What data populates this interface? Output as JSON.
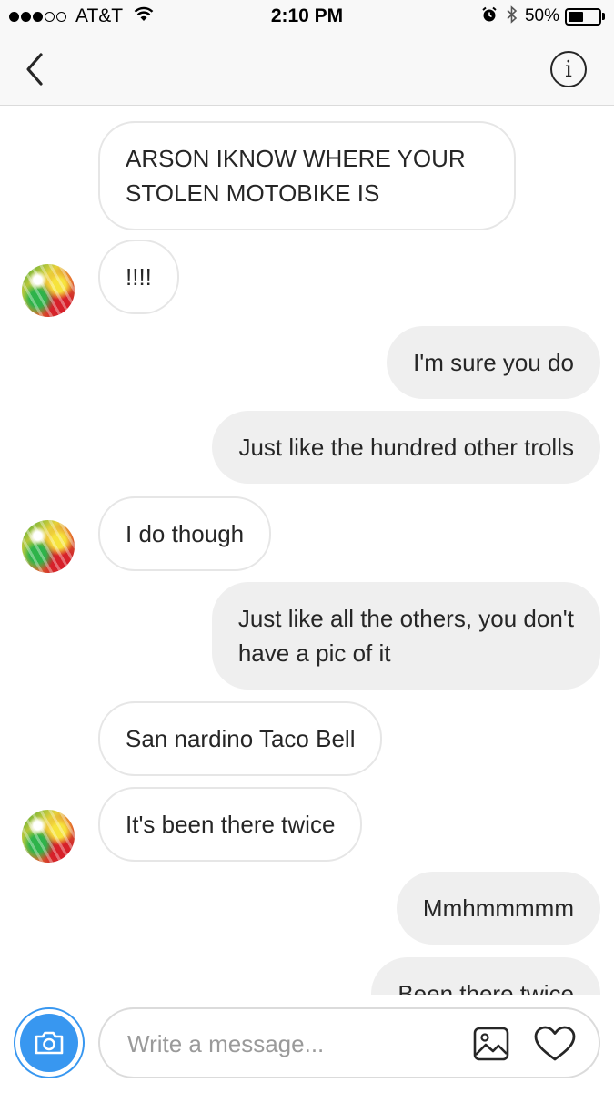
{
  "status_bar": {
    "carrier": "AT&T",
    "time": "2:10 PM",
    "battery_percent": "50%",
    "battery_level": 0.5,
    "signal_bars_filled": 3,
    "signal_bars_total": 5
  },
  "nav": {
    "back_icon": "chevron-left-icon",
    "info_icon": "info-icon",
    "info_glyph": "i"
  },
  "messages": [
    {
      "direction": "incoming",
      "text_lines": [
        "ARSON IKNOW WHERE YOUR",
        "STOLEN MOTOBIKE IS"
      ]
    },
    {
      "direction": "incoming",
      "text": "!!!!",
      "avatar": true
    },
    {
      "direction": "outgoing",
      "text": "I'm sure you do"
    },
    {
      "direction": "outgoing",
      "text": "Just like the hundred other trolls"
    },
    {
      "direction": "incoming",
      "text": "I do though",
      "avatar": true
    },
    {
      "direction": "outgoing",
      "text_lines": [
        "Just like all the others, you don't",
        "have a pic of it"
      ]
    },
    {
      "direction": "incoming",
      "text": "San nardino Taco Bell"
    },
    {
      "direction": "incoming",
      "text": "It's been there twice",
      "avatar": true
    },
    {
      "direction": "outgoing",
      "text": "Mmhmmmmm"
    },
    {
      "direction": "outgoing",
      "text": "Been there twice",
      "partially_visible": true
    }
  ],
  "composer": {
    "placeholder": "Write a message...",
    "camera_icon": "camera-icon",
    "gallery_icon": "image-icon",
    "like_icon": "heart-icon"
  },
  "colors": {
    "accent": "#3897f0",
    "outgoing_bubble": "#efefef",
    "incoming_border": "#e6e6e6",
    "text": "#262626",
    "placeholder": "#9a9a9a"
  }
}
